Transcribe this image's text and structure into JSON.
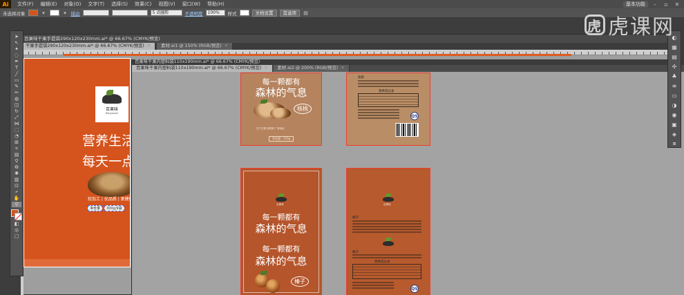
{
  "menubar": {
    "app_logo": "Ai",
    "items": [
      "文件(F)",
      "编辑(E)",
      "对象(O)",
      "文字(T)",
      "选择(S)",
      "效果(C)",
      "视图(V)",
      "窗口(W)",
      "帮助(H)"
    ],
    "workspace": "基本功能",
    "window_controls": [
      "minimize-icon",
      "restore-icon",
      "close-icon"
    ]
  },
  "controlbar": {
    "selection_state": "未选择对象",
    "fill_color": "#d4541c",
    "stroke_label": "描边",
    "stroke_width": "",
    "brush_size": "5 点圆形",
    "opacity_label": "不透明度",
    "opacity_value": "100%",
    "style_label": "样式",
    "doc_setup": "文档设置",
    "preferences": "首选项"
  },
  "watermark": {
    "logo_char": "虎",
    "text": "虎课网"
  },
  "doc1": {
    "tabs": [
      {
        "label": "干果手提袋290x120x230mm.ai* @ 66.67% (CMYK/预览)",
        "active": true
      },
      {
        "label": "素材.ai1 @ 150% (RGB/预览)",
        "active": false
      }
    ],
    "window_title": "百果味干果手提袋290x120x230mm.ai* @ 66.67% (CMYK/预览)"
  },
  "doc2": {
    "title": "百果味干果内塑料袋110x190mm.ai* @ 66.67% (CMYK/预览)",
    "tabs": [
      {
        "label": "百果味干果内塑料袋110x190mm.ai* @ 66.67% (CMYK/预览)",
        "active": true
      },
      {
        "label": "素材.ai2 @ 200% (RGB/预览)",
        "active": false
      }
    ]
  },
  "orange_bag": {
    "logo_name": "百果味",
    "logo_sub": "Baiguowei",
    "slogan_1": "营养生活",
    "slogan_2": "每天一点干",
    "features": "轻加工 | 优品质 | 更健康",
    "tags": [
      "净含量",
      "300g/9袋"
    ]
  },
  "packs": {
    "walnut_front": {
      "slogan_a": "每一颗都有",
      "slogan_b": "森林的气息",
      "flavor": "核桃",
      "net_badge": "净含量：150g",
      "meta": "生产日期  保质期  厂家地址"
    },
    "hazelnut_front": {
      "logo_name": "百果味",
      "slogan_a": "每一颗都有",
      "slogan_b": "森林的气息",
      "flavor": "榛子"
    },
    "walnut_back": {
      "header": "核桃",
      "table_title": "营养成分表",
      "qs": "QS"
    },
    "hazelnut_back": {
      "logo_name": "百果味",
      "header_top": "榛子",
      "header_bottom": "榛子",
      "table_title": "营养成分表",
      "qs": "QS"
    }
  },
  "colors": {
    "accent": "#e05a20",
    "selection_outline": "#f03c2c",
    "walnut_bg": "#b5835e",
    "hazelnut_bg": "#b5552b"
  }
}
